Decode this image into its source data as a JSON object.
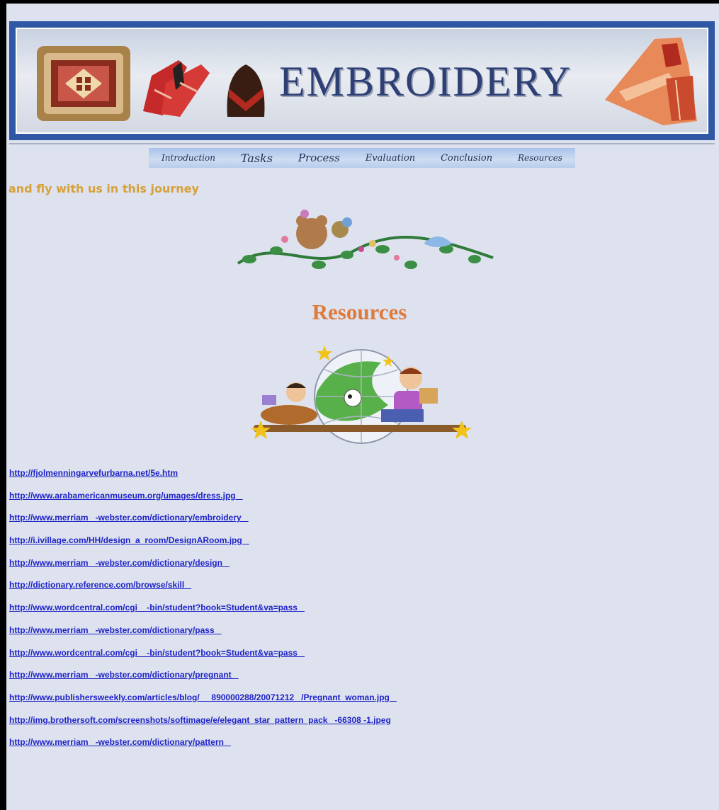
{
  "banner": {
    "title": "EMBROIDERY"
  },
  "nav": {
    "items": [
      "Introduction",
      "Tasks",
      "Process",
      "Evaluation",
      "Conclusion",
      "Resources"
    ]
  },
  "tagline": "and fly with us in this journey",
  "section": {
    "title": "Resources"
  },
  "links": [
    "http://fjolmenningarvefurbarna.net/5e.htm",
    "http://www.arabamericanmuseum.org/umages/dress.jpg   ",
    "http://www.merriam   -webster.com/dictionary/embroidery   ",
    "http://i.ivillage.com/HH/design  a  room/DesignARoom.jpg   ",
    "http://www.merriam   -webster.com/dictionary/design   ",
    "http://dictionary.reference.com/browse/skill   ",
    "http://www.wordcentral.com/cgi    -bin/student?book=Student&va=pass   ",
    "http://www.merriam   -webster.com/dictionary/pass   ",
    "http://www.wordcentral.com/cgi    -bin/student?book=Student&va=pass   ",
    "http://www.merriam   -webster.com/dictionary/pregnant   ",
    "http://www.publishersweekly.com/articles/blog/     890000288/20071212   /Pregnant  woman.jpg   ",
    "http://img.brothersoft.com/screenshots/softimage/e/elegant  star  pattern  pack   -66308 -1.jpeg",
    "http://www.merriam   -webster.com/dictionary/pattern   "
  ]
}
